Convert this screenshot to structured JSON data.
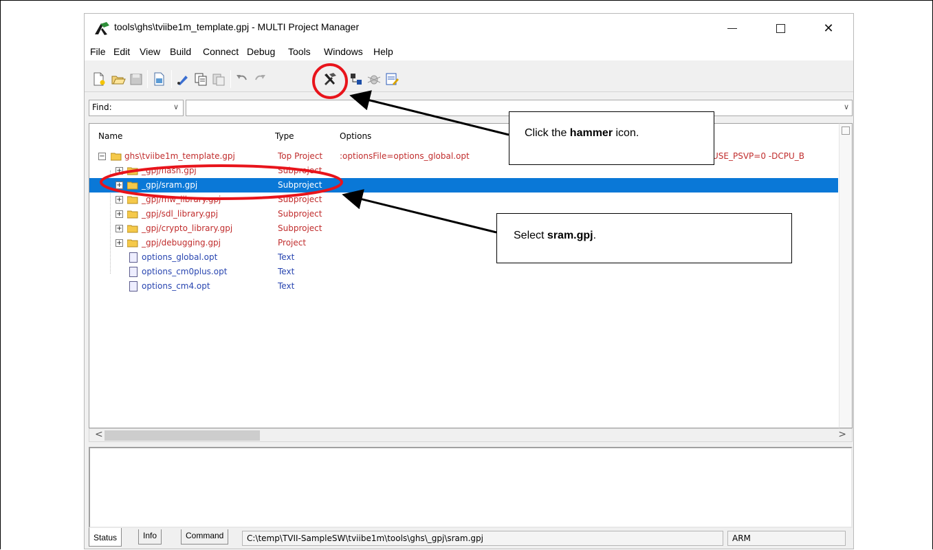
{
  "window": {
    "title": "tools\\ghs\\tviibe1m_template.gpj - MULTI Project Manager",
    "controls": {
      "minimize": "—",
      "maximize": "□",
      "close": "✕"
    }
  },
  "menu": {
    "file": "File",
    "edit": "Edit",
    "view": "View",
    "build": "Build",
    "connect": "Connect",
    "debug": "Debug",
    "tools": "Tools",
    "windows": "Windows",
    "help": "Help"
  },
  "toolbar": {
    "icons": [
      "new-file",
      "open-folder",
      "save",
      "new-project",
      "edit",
      "copy",
      "paste",
      "undo",
      "redo",
      "build-hammer",
      "connect",
      "debug-bug",
      "notes"
    ]
  },
  "find": {
    "label": "Find:",
    "value": ""
  },
  "tree": {
    "headers": {
      "name": "Name",
      "type": "Type",
      "options": "Options"
    },
    "rows": [
      {
        "name": "ghs\\tviibe1m_template.gpj",
        "type": "Top Project",
        "options": ":optionsFile=options_global.opt",
        "options_tail": "_USE_PSVP=0 -DCPU_B",
        "color": "#c02c2c"
      },
      {
        "name": "_gpj/flash.gpj",
        "type": "Subproject",
        "options": "",
        "color": "#c02c2c"
      },
      {
        "name": "_gpj/sram.gpj",
        "type": "Subproject",
        "options": "",
        "color": "#ffffff",
        "selected": true
      },
      {
        "name": "_gpj/mw_library.gpj",
        "type": "Subproject",
        "options": "",
        "color": "#c02c2c"
      },
      {
        "name": "_gpj/sdl_library.gpj",
        "type": "Subproject",
        "options": "",
        "color": "#c02c2c"
      },
      {
        "name": "_gpj/crypto_library.gpj",
        "type": "Subproject",
        "options": "",
        "color": "#c02c2c"
      },
      {
        "name": "_gpj/debugging.gpj",
        "type": "Project",
        "options": "",
        "color": "#c02c2c"
      },
      {
        "name": "options_global.opt",
        "type": "Text",
        "options": "",
        "color": "#2845b0"
      },
      {
        "name": "options_cm0plus.opt",
        "type": "Text",
        "options": "",
        "color": "#2845b0"
      },
      {
        "name": "options_cm4.opt",
        "type": "Text",
        "options": "",
        "color": "#2845b0"
      }
    ]
  },
  "scroll": {
    "left": "<",
    "right": ">"
  },
  "tabs": {
    "status": "Status",
    "info": "Info",
    "command": "Command"
  },
  "statusbar": {
    "path": "C:\\temp\\TVII-SampleSW\\tviibe1m\\tools\\ghs\\_gpj\\sram.gpj",
    "arch": "ARM"
  },
  "callouts": {
    "hammer": {
      "prefix": "Click the ",
      "bold": "hammer",
      "suffix": " icon."
    },
    "sram": {
      "prefix": "Select ",
      "bold": "sram.gpj",
      "suffix": "."
    }
  },
  "colors": {
    "selection": "#0a78d7",
    "annotation": "#e8141b",
    "project_text": "#c02c2c",
    "file_text": "#2845b0"
  }
}
